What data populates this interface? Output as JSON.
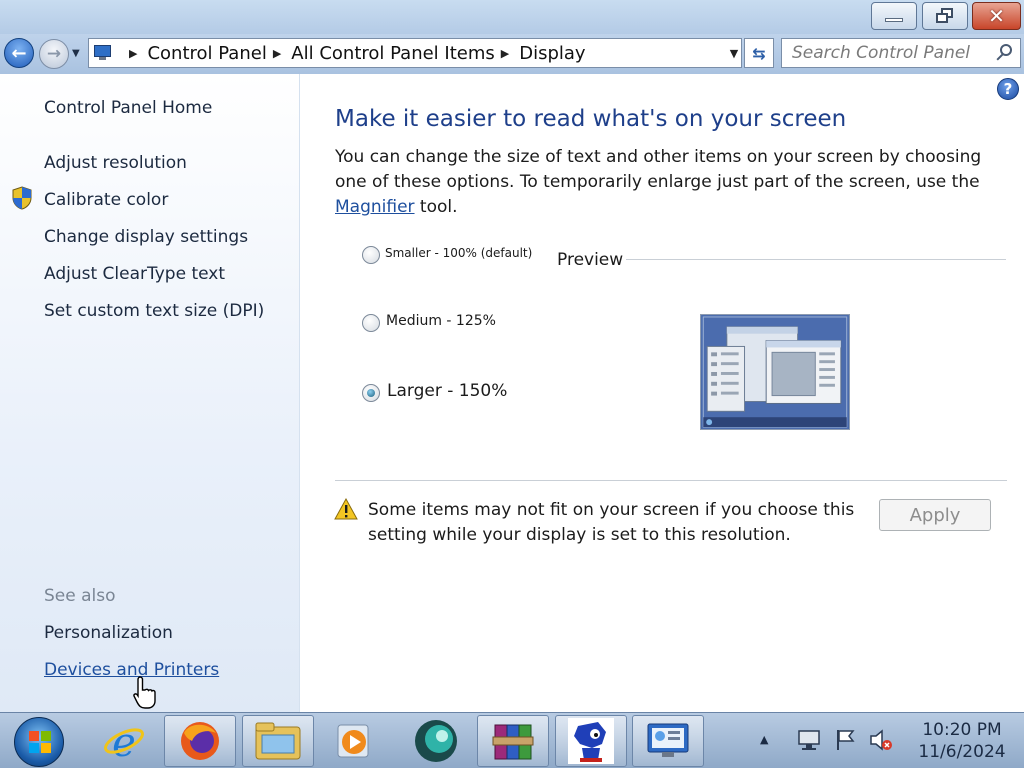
{
  "window": {
    "buttons": {
      "minimize": "minimize",
      "maximize": "restore",
      "close": "close"
    }
  },
  "address_bar": {
    "breadcrumbs": [
      "Control Panel",
      "All Control Panel Items",
      "Display"
    ],
    "search_placeholder": "Search Control Panel"
  },
  "sidebar": {
    "home": "Control Panel Home",
    "tasks": [
      "Adjust resolution",
      "Calibrate color",
      "Change display settings",
      "Adjust ClearType text",
      "Set custom text size (DPI)"
    ],
    "see_also_heading": "See also",
    "see_also": [
      "Personalization",
      "Devices and Printers"
    ]
  },
  "main": {
    "heading": "Make it easier to read what's on your screen",
    "description_before": "You can change the size of text and other items on your screen by choosing one of these options. To temporarily enlarge just part of the screen, use the ",
    "description_link": "Magnifier",
    "description_after": " tool.",
    "options": [
      {
        "label": "Smaller - 100% (default)",
        "checked": false
      },
      {
        "label": "Medium - 125%",
        "checked": false
      },
      {
        "label": "Larger - 150%",
        "checked": true
      }
    ],
    "preview_label": "Preview",
    "warning": "Some items may not fit on your screen if you choose this setting while your display is set to this resolution.",
    "apply_label": "Apply",
    "help_glyph": "?"
  },
  "taskbar": {
    "apps": [
      "internet-explorer",
      "firefox",
      "windows-explorer",
      "windows-media-player",
      "app-teal-orb",
      "winrar",
      "sonic-game",
      "control-panel-display"
    ],
    "clock_time": "10:20 PM",
    "clock_date": "11/6/2024"
  },
  "colors": {
    "link": "#1e4f9e",
    "heading": "#1e3f8a",
    "taskbar": "#a3bcd9"
  }
}
